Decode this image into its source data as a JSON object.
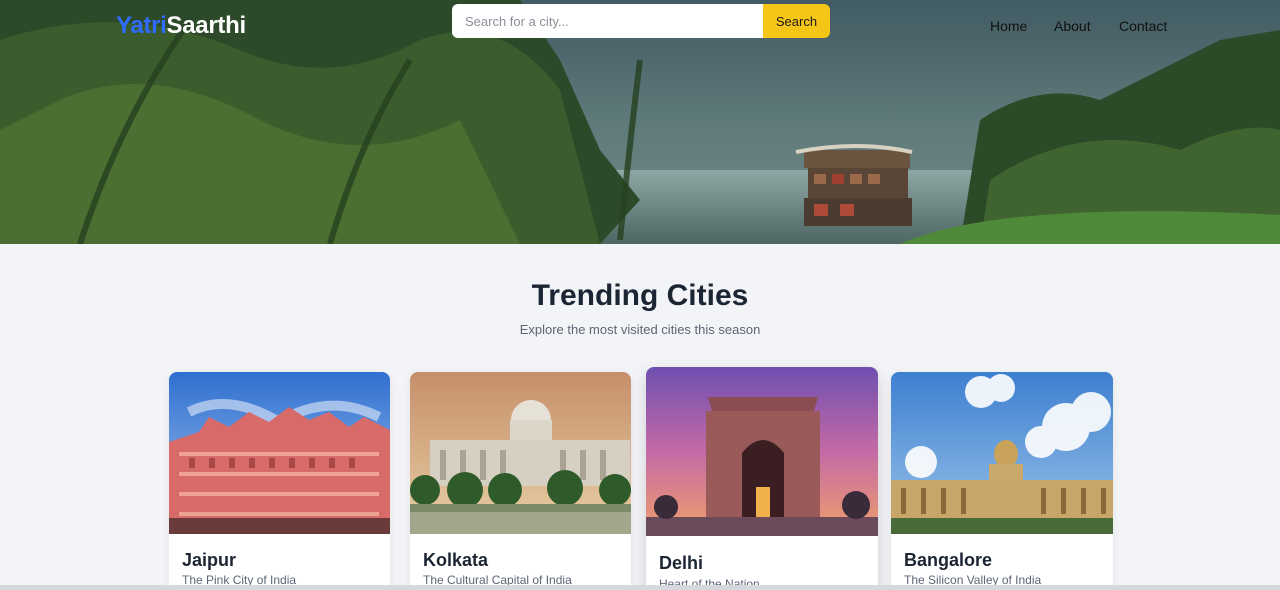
{
  "brand": {
    "part1": "Yatri",
    "part2": "Saarthi"
  },
  "search": {
    "placeholder": "Search for a city...",
    "button_label": "Search"
  },
  "nav": {
    "home": "Home",
    "about": "About",
    "contact": "Contact"
  },
  "section": {
    "title": "Trending Cities",
    "subtitle": "Explore the most visited cities this season"
  },
  "cities": [
    {
      "name": "Jaipur",
      "tagline": "The Pink City of India"
    },
    {
      "name": "Kolkata",
      "tagline": "The Cultural Capital of India"
    },
    {
      "name": "Delhi",
      "tagline": "Heart of the Nation"
    },
    {
      "name": "Bangalore",
      "tagline": "The Silicon Valley of India"
    }
  ],
  "colors": {
    "brand_blue": "#2f6bff",
    "search_button": "#f5c518",
    "heading": "#1c2533"
  }
}
